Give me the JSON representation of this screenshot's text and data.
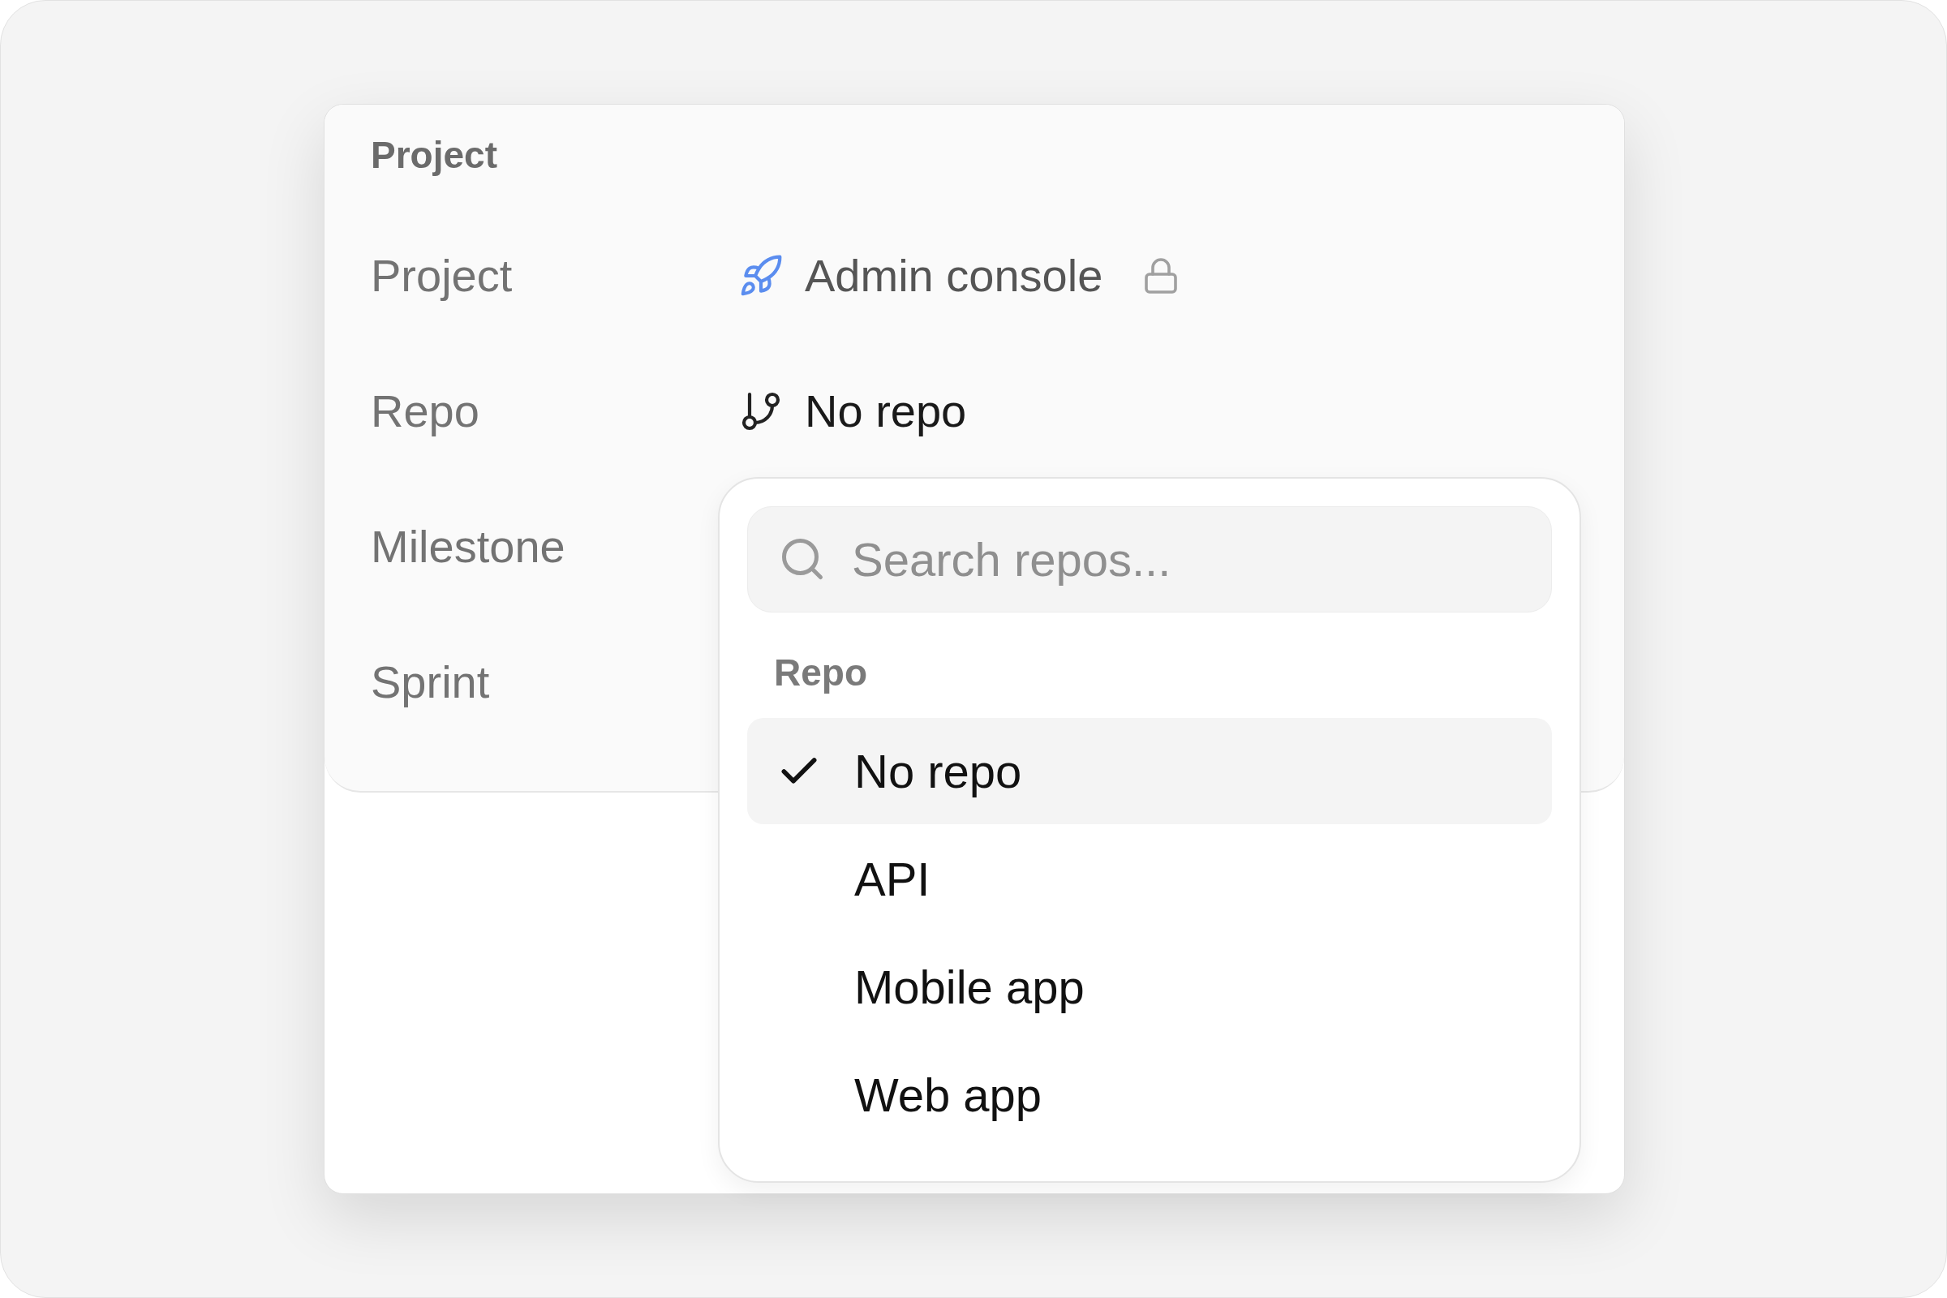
{
  "section": {
    "title": "Project"
  },
  "fields": [
    {
      "label": "Project",
      "value": "Admin console",
      "kind": "project",
      "locked": true
    },
    {
      "label": "Repo",
      "value": "No repo",
      "kind": "repo",
      "locked": false
    },
    {
      "label": "Milestone"
    },
    {
      "label": "Sprint"
    }
  ],
  "dropdown": {
    "search": {
      "placeholder": "Search repos..."
    },
    "group_label": "Repo",
    "options": [
      {
        "label": "No repo",
        "selected": true
      },
      {
        "label": "API",
        "selected": false
      },
      {
        "label": "Mobile app",
        "selected": false
      },
      {
        "label": "Web app",
        "selected": false
      }
    ]
  }
}
